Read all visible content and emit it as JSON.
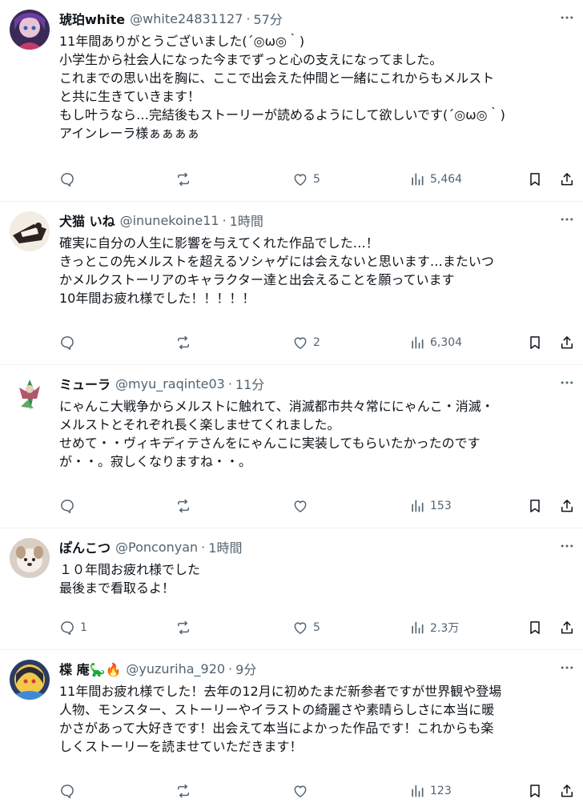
{
  "posts": [
    {
      "name": "琥珀white",
      "handle": "@white24831127",
      "time": "57分",
      "lines": [
        "11年間ありがとうございました(´◎ω◎｀)",
        "小学生から社会人になった今までずっと心の支えになってました。",
        "これまでの思い出を胸に、ここで出会えた仲間と一緒にこれからもメルスト",
        "と共に生きていきます！",
        "もし叶うなら…完結後もストーリーが読めるようにして欲しいです(´◎ω◎｀)",
        "アインレーラ様ぁぁぁぁ"
      ],
      "replies": "",
      "reposts": "",
      "likes": "5",
      "views": "5,464"
    },
    {
      "name": "犬猫 いね",
      "handle": "@inunekoine11",
      "time": "1時間",
      "lines": [
        "確実に自分の人生に影響を与えてくれた作品でした…！",
        "きっとこの先メルストを超えるソシャゲには会えないと思います…またいつ",
        "かメルクストーリアのキャラクター達と出会えることを願っています",
        "10年間お疲れ様でした！！！！！"
      ],
      "replies": "",
      "reposts": "",
      "likes": "2",
      "views": "6,304"
    },
    {
      "name": "ミューラ",
      "handle": "@myu_raqinte03",
      "time": "11分",
      "lines": [
        "にゃんこ大戦争からメルストに触れて、消滅都市共々常ににゃんこ・消滅・",
        "メルストとそれぞれ長く楽しませてくれました。",
        "せめて・・ヴィキディテさんをにゃんこに実装してもらいたかったのです",
        "が・・。寂しくなりますね・・。"
      ],
      "replies": "",
      "reposts": "",
      "likes": "",
      "views": "153"
    },
    {
      "name": "ぽんこつ",
      "handle": "@Ponconyan",
      "time": "1時間",
      "lines": [
        "１０年間お疲れ様でした",
        "最後まで看取るよ！"
      ],
      "replies": "1",
      "reposts": "",
      "likes": "5",
      "views": "2.3万"
    },
    {
      "name": "楪 庵🦕🔥",
      "handle": "@yuzuriha_920",
      "time": "9分",
      "lines": [
        "11年間お疲れ様でした！去年の12月に初めたまだ新参者ですが世界観や登場",
        "人物、モンスター、ストーリーやイラストの綺麗さや素晴らしさに本当に暖",
        "かさがあって大好きです！出会えて本当によかった作品です！これからも楽",
        "しくストーリーを読ませていただきます！"
      ],
      "replies": "",
      "reposts": "",
      "likes": "",
      "views": "123"
    }
  ],
  "icons": {
    "more": "more-icon",
    "reply": "reply-icon",
    "repost": "repost-icon",
    "like": "like-icon",
    "views": "views-icon",
    "bookmark": "bookmark-icon",
    "share": "share-icon"
  },
  "colors": {
    "text": "#0f1419",
    "secondary": "#536471",
    "divider": "#eff3f4"
  }
}
